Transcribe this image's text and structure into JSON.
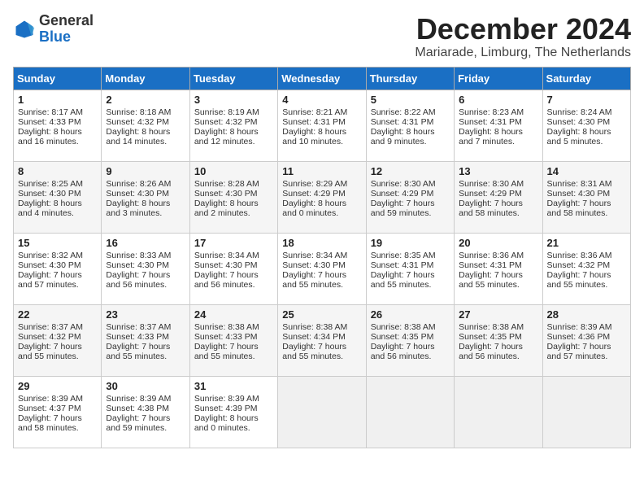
{
  "header": {
    "logo": {
      "general": "General",
      "blue": "Blue"
    },
    "title": "December 2024",
    "location": "Mariarade, Limburg, The Netherlands"
  },
  "weekdays": [
    "Sunday",
    "Monday",
    "Tuesday",
    "Wednesday",
    "Thursday",
    "Friday",
    "Saturday"
  ],
  "weeks": [
    [
      {
        "day": "1",
        "sunrise": "8:17 AM",
        "sunset": "4:33 PM",
        "daylight": "8 hours and 16 minutes."
      },
      {
        "day": "2",
        "sunrise": "8:18 AM",
        "sunset": "4:32 PM",
        "daylight": "8 hours and 14 minutes."
      },
      {
        "day": "3",
        "sunrise": "8:19 AM",
        "sunset": "4:32 PM",
        "daylight": "8 hours and 12 minutes."
      },
      {
        "day": "4",
        "sunrise": "8:21 AM",
        "sunset": "4:31 PM",
        "daylight": "8 hours and 10 minutes."
      },
      {
        "day": "5",
        "sunrise": "8:22 AM",
        "sunset": "4:31 PM",
        "daylight": "8 hours and 9 minutes."
      },
      {
        "day": "6",
        "sunrise": "8:23 AM",
        "sunset": "4:31 PM",
        "daylight": "8 hours and 7 minutes."
      },
      {
        "day": "7",
        "sunrise": "8:24 AM",
        "sunset": "4:30 PM",
        "daylight": "8 hours and 5 minutes."
      }
    ],
    [
      {
        "day": "8",
        "sunrise": "8:25 AM",
        "sunset": "4:30 PM",
        "daylight": "8 hours and 4 minutes."
      },
      {
        "day": "9",
        "sunrise": "8:26 AM",
        "sunset": "4:30 PM",
        "daylight": "8 hours and 3 minutes."
      },
      {
        "day": "10",
        "sunrise": "8:28 AM",
        "sunset": "4:30 PM",
        "daylight": "8 hours and 2 minutes."
      },
      {
        "day": "11",
        "sunrise": "8:29 AM",
        "sunset": "4:29 PM",
        "daylight": "8 hours and 0 minutes."
      },
      {
        "day": "12",
        "sunrise": "8:30 AM",
        "sunset": "4:29 PM",
        "daylight": "7 hours and 59 minutes."
      },
      {
        "day": "13",
        "sunrise": "8:30 AM",
        "sunset": "4:29 PM",
        "daylight": "7 hours and 58 minutes."
      },
      {
        "day": "14",
        "sunrise": "8:31 AM",
        "sunset": "4:30 PM",
        "daylight": "7 hours and 58 minutes."
      }
    ],
    [
      {
        "day": "15",
        "sunrise": "8:32 AM",
        "sunset": "4:30 PM",
        "daylight": "7 hours and 57 minutes."
      },
      {
        "day": "16",
        "sunrise": "8:33 AM",
        "sunset": "4:30 PM",
        "daylight": "7 hours and 56 minutes."
      },
      {
        "day": "17",
        "sunrise": "8:34 AM",
        "sunset": "4:30 PM",
        "daylight": "7 hours and 56 minutes."
      },
      {
        "day": "18",
        "sunrise": "8:34 AM",
        "sunset": "4:30 PM",
        "daylight": "7 hours and 55 minutes."
      },
      {
        "day": "19",
        "sunrise": "8:35 AM",
        "sunset": "4:31 PM",
        "daylight": "7 hours and 55 minutes."
      },
      {
        "day": "20",
        "sunrise": "8:36 AM",
        "sunset": "4:31 PM",
        "daylight": "7 hours and 55 minutes."
      },
      {
        "day": "21",
        "sunrise": "8:36 AM",
        "sunset": "4:32 PM",
        "daylight": "7 hours and 55 minutes."
      }
    ],
    [
      {
        "day": "22",
        "sunrise": "8:37 AM",
        "sunset": "4:32 PM",
        "daylight": "7 hours and 55 minutes."
      },
      {
        "day": "23",
        "sunrise": "8:37 AM",
        "sunset": "4:33 PM",
        "daylight": "7 hours and 55 minutes."
      },
      {
        "day": "24",
        "sunrise": "8:38 AM",
        "sunset": "4:33 PM",
        "daylight": "7 hours and 55 minutes."
      },
      {
        "day": "25",
        "sunrise": "8:38 AM",
        "sunset": "4:34 PM",
        "daylight": "7 hours and 55 minutes."
      },
      {
        "day": "26",
        "sunrise": "8:38 AM",
        "sunset": "4:35 PM",
        "daylight": "7 hours and 56 minutes."
      },
      {
        "day": "27",
        "sunrise": "8:38 AM",
        "sunset": "4:35 PM",
        "daylight": "7 hours and 56 minutes."
      },
      {
        "day": "28",
        "sunrise": "8:39 AM",
        "sunset": "4:36 PM",
        "daylight": "7 hours and 57 minutes."
      }
    ],
    [
      {
        "day": "29",
        "sunrise": "8:39 AM",
        "sunset": "4:37 PM",
        "daylight": "7 hours and 58 minutes."
      },
      {
        "day": "30",
        "sunrise": "8:39 AM",
        "sunset": "4:38 PM",
        "daylight": "7 hours and 59 minutes."
      },
      {
        "day": "31",
        "sunrise": "8:39 AM",
        "sunset": "4:39 PM",
        "daylight": "8 hours and 0 minutes."
      },
      null,
      null,
      null,
      null
    ]
  ]
}
